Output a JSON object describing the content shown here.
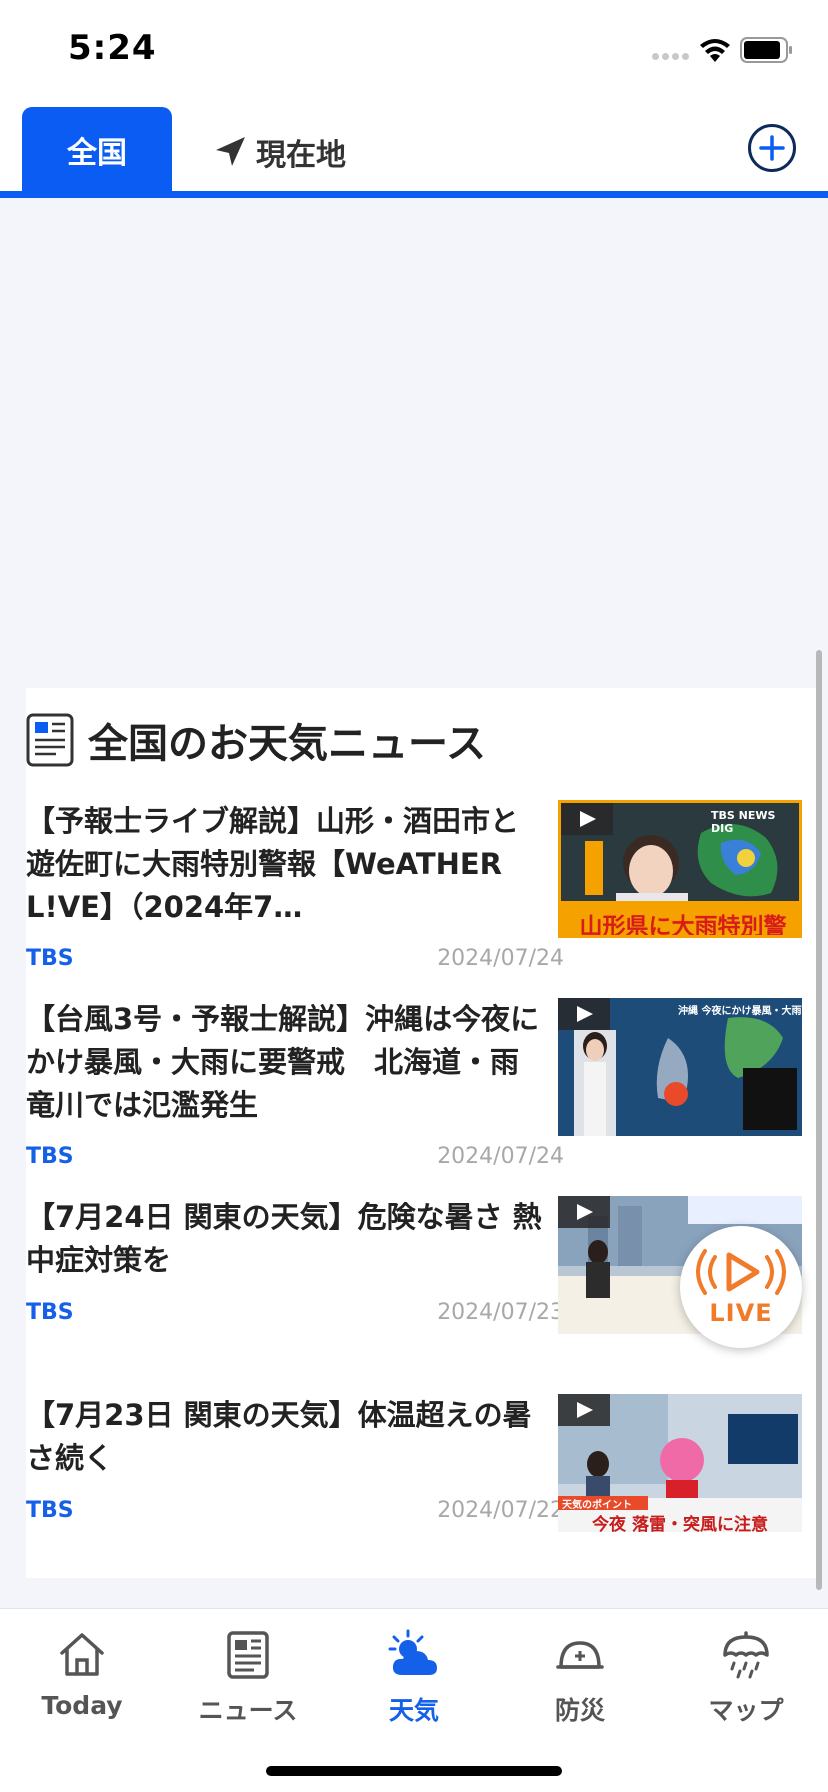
{
  "status_bar": {
    "time": "5:24"
  },
  "top_tabs": {
    "active_label": "全国",
    "location_label": "現在地"
  },
  "news": {
    "section_title": "全国のお天気ニュース",
    "items": [
      {
        "title": "【予報士ライブ解説】山形・酒田市と遊佐町に大雨特別警報【WeATHER L!VE】（2024年7…",
        "source": "TBS",
        "date": "2024/07/24",
        "thumb_caption": "山形県に大雨特別警報",
        "thumb_tag": "TBS NEWS DIG"
      },
      {
        "title": "【台風3号・予報士解説】沖縄は今夜にかけ暴風・大雨に要警戒　北海道・雨竜川では氾濫発生",
        "source": "TBS",
        "date": "2024/07/24",
        "thumb_tag": "沖縄 今夜にかけ暴風・大雨警戒"
      },
      {
        "title": "【7月24日 関東の天気】危険な暑さ 熱中症対策を",
        "source": "TBS",
        "date": "2024/07/23"
      },
      {
        "title": "【7月23日 関東の天気】体温超えの暑さ続く",
        "source": "TBS",
        "date": "2024/07/22",
        "thumb_caption": "今夜 落雷・突風に注意",
        "thumb_tag": "天気のポイント"
      }
    ]
  },
  "live_button": {
    "label": "LIVE"
  },
  "bottom_tabs": [
    {
      "label": "Today",
      "icon": "home-icon",
      "active": false
    },
    {
      "label": "ニュース",
      "icon": "newspaper-icon",
      "active": false
    },
    {
      "label": "天気",
      "icon": "weather-icon",
      "active": true
    },
    {
      "label": "防災",
      "icon": "helmet-icon",
      "active": false
    },
    {
      "label": "マップ",
      "icon": "umbrella-map-icon",
      "active": false
    }
  ],
  "colors": {
    "accent": "#0a5cf2",
    "source_blue": "#1560e8",
    "live_orange": "#f07b2a",
    "background": "#f3f5fb"
  }
}
